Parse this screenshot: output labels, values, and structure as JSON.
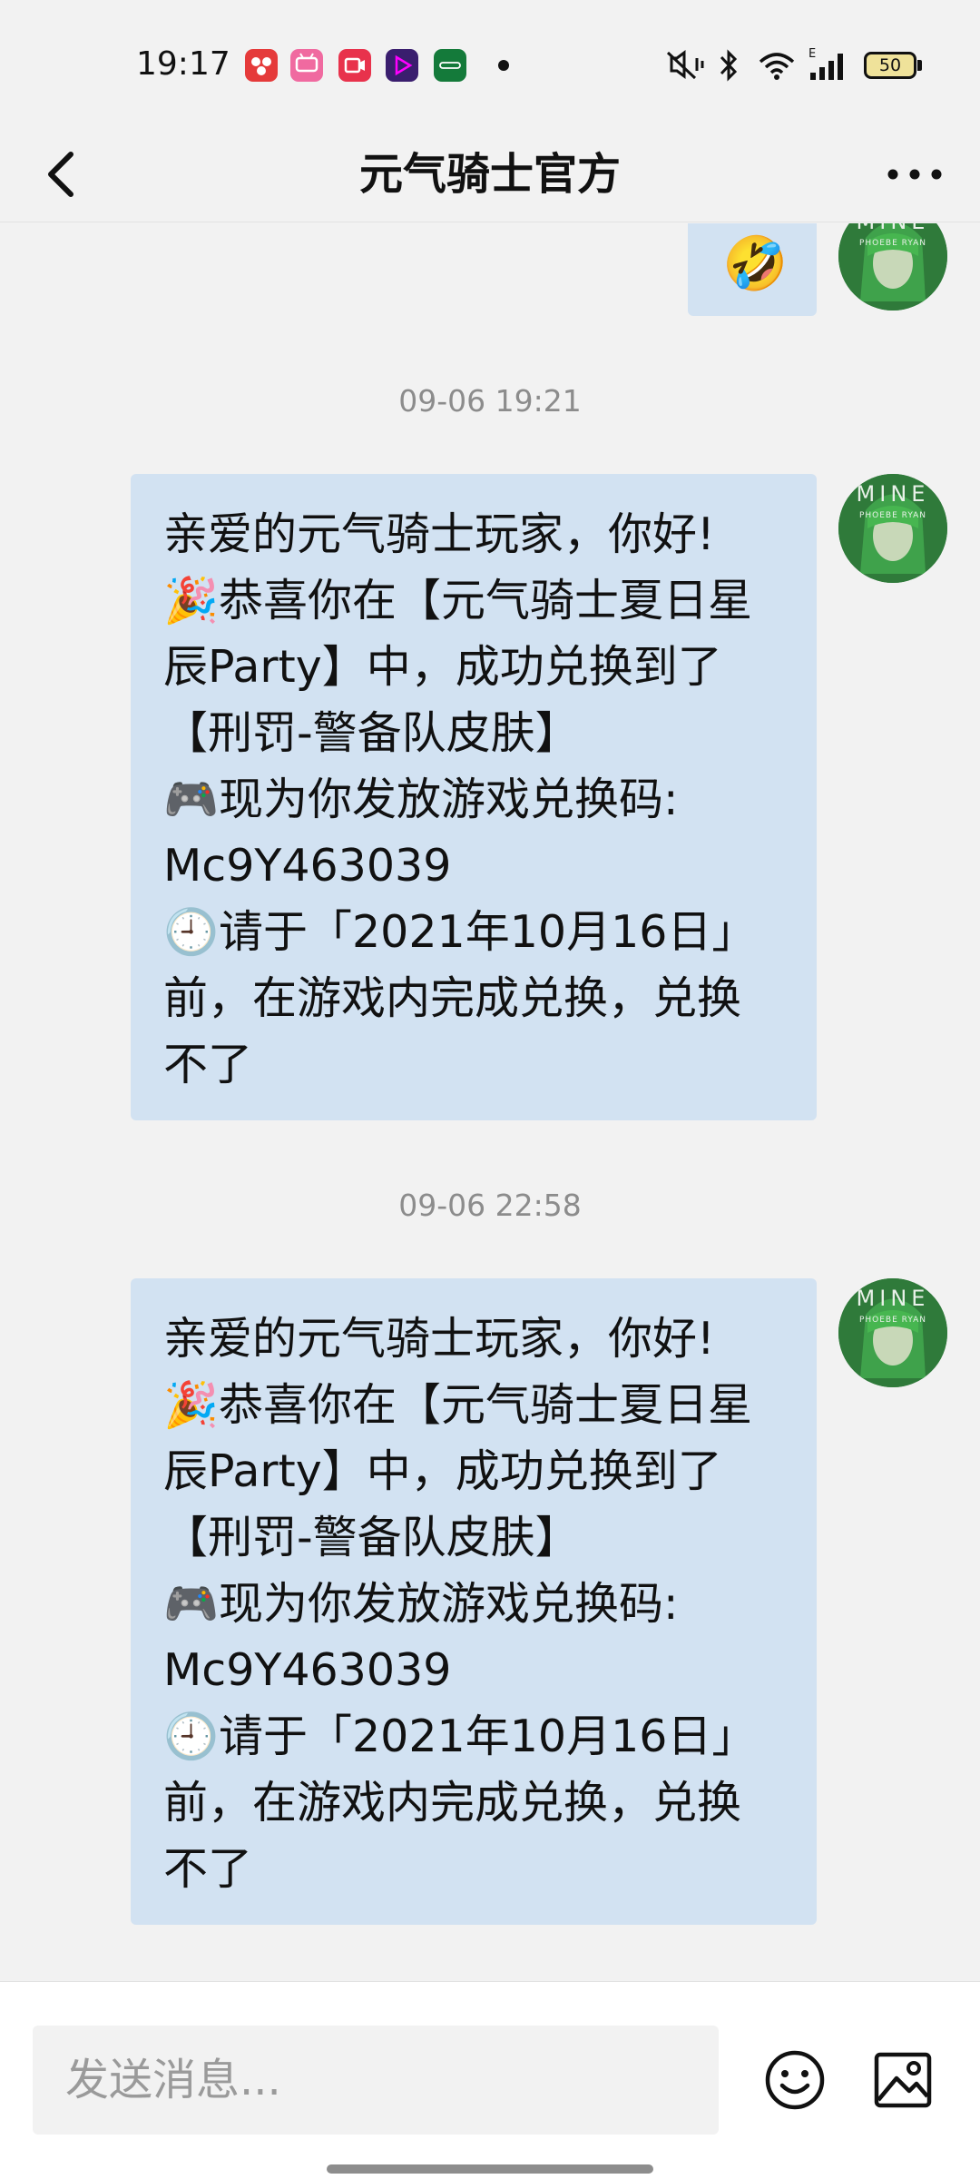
{
  "status_bar": {
    "time": "19:17",
    "app_icons": [
      "app-notification-icon",
      "bilibili-icon",
      "video-app-icon",
      "media-player-icon",
      "oppo-app-icon"
    ],
    "battery": "50"
  },
  "header": {
    "back_icon": "chevron-left-icon",
    "title": "元气骑士官方",
    "more_icon": "more-dots-icon"
  },
  "messages": [
    {
      "type": "emoji",
      "emoji": "🤣"
    },
    {
      "type": "text",
      "time": "09-06 19:21",
      "lines": [
        "亲爱的元气骑士玩家，你好!",
        "🎉恭喜你在【元气骑士夏日星",
        "辰Party】中，成功兑换到了",
        "【刑罚-警备队皮肤】",
        "🎮现为你发放游戏兑换码:",
        "Mc9Y463039",
        "🕘请于「2021年10月16日」",
        "前，在游戏内完成兑换，兑换",
        "不了"
      ]
    },
    {
      "type": "text",
      "time": "09-06 22:58",
      "lines": [
        "亲爱的元气骑士玩家，你好!",
        "🎉恭喜你在【元气骑士夏日星",
        "辰Party】中，成功兑换到了",
        "【刑罚-警备队皮肤】",
        "🎮现为你发放游戏兑换码:",
        "Mc9Y463039",
        "🕘请于「2021年10月16日」",
        "前，在游戏内完成兑换，兑换",
        "不了"
      ]
    }
  ],
  "avatar": {
    "lettering": [
      "MINE",
      "PHOEBE RYAN"
    ],
    "accent_color": "#2f7a3a"
  },
  "input": {
    "placeholder": "发送消息...",
    "value": ""
  },
  "toolbar_icons": [
    "smiley-icon",
    "image-icon"
  ],
  "colors": {
    "bubble": "#d2e2f2",
    "background": "#f2f2f2",
    "timestamp": "#8c8c8c"
  }
}
